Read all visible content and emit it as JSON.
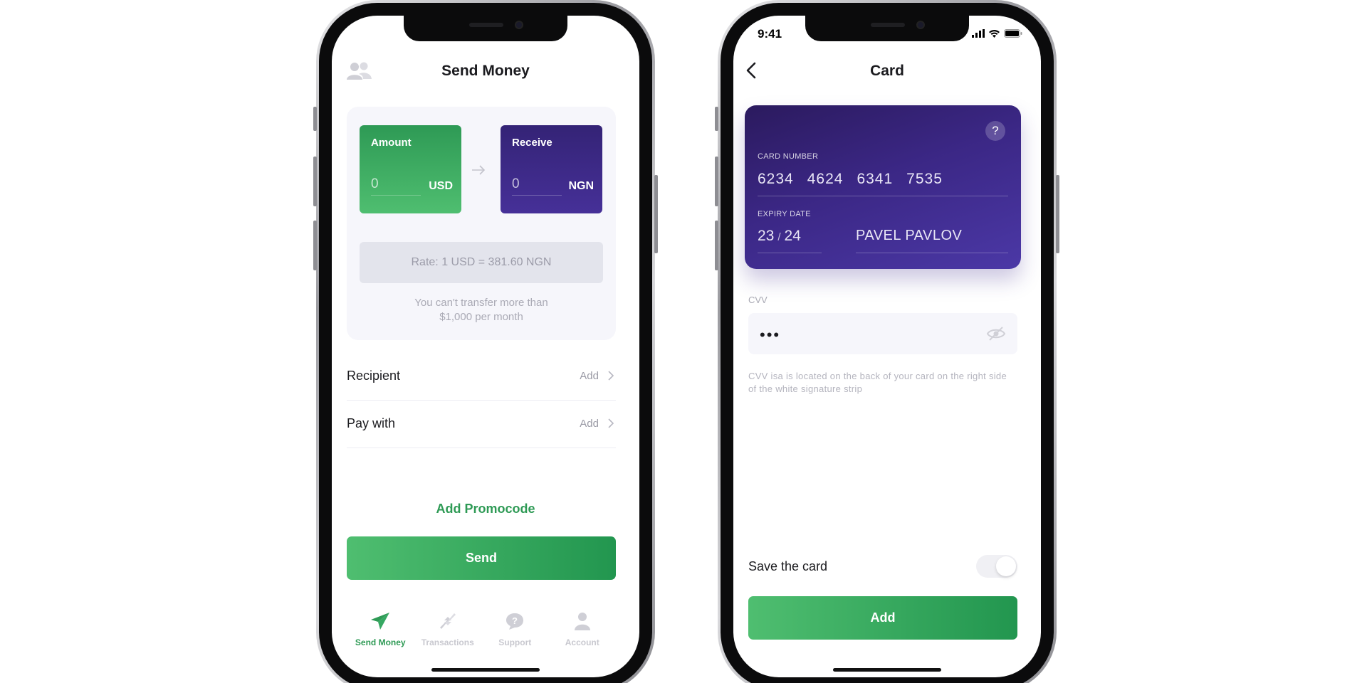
{
  "send_screen": {
    "title": "Send Money",
    "amount_card": {
      "label": "Amount",
      "value": "0",
      "currency": "USD"
    },
    "receive_card": {
      "label": "Receive",
      "value": "0",
      "currency": "NGN"
    },
    "rate": "Rate: 1 USD = 381.60 NGN",
    "limit_line1": "You can't transfer more than",
    "limit_line2": "$1,000 per month",
    "rows": [
      {
        "label": "Recipient",
        "action": "Add"
      },
      {
        "label": "Pay with",
        "action": "Add"
      }
    ],
    "promo": "Add Promocode",
    "send_button": "Send",
    "tabs": [
      {
        "label": "Send Money",
        "icon": "paper-plane-icon",
        "active": true
      },
      {
        "label": "Transactions",
        "icon": "transfer-arrows-icon",
        "active": false
      },
      {
        "label": "Support",
        "icon": "question-bubble-icon",
        "active": false
      },
      {
        "label": "Account",
        "icon": "person-icon",
        "active": false
      }
    ]
  },
  "card_screen": {
    "status_time": "9:41",
    "title": "Card",
    "card": {
      "help": "?",
      "number_caption": "CARD NUMBER",
      "number_groups": [
        "6234",
        "4624",
        "6341",
        "7535"
      ],
      "expiry_caption": "EXPIRY DATE",
      "expiry_month": "23",
      "expiry_sep": "/",
      "expiry_year": "24",
      "holder": "PAVEL PAVLOV"
    },
    "cvv_label": "CVV",
    "cvv_value": "•••",
    "cvv_hint": "CVV isa is located on the back of your card on the right side of the white signature strip",
    "save_label": "Save the card",
    "save_toggle": "on",
    "add_button": "Add"
  },
  "colors": {
    "green": "#2e9a55",
    "green_light": "#4fbe70",
    "purple": "#3b2785",
    "muted": "#9a9aa5"
  }
}
